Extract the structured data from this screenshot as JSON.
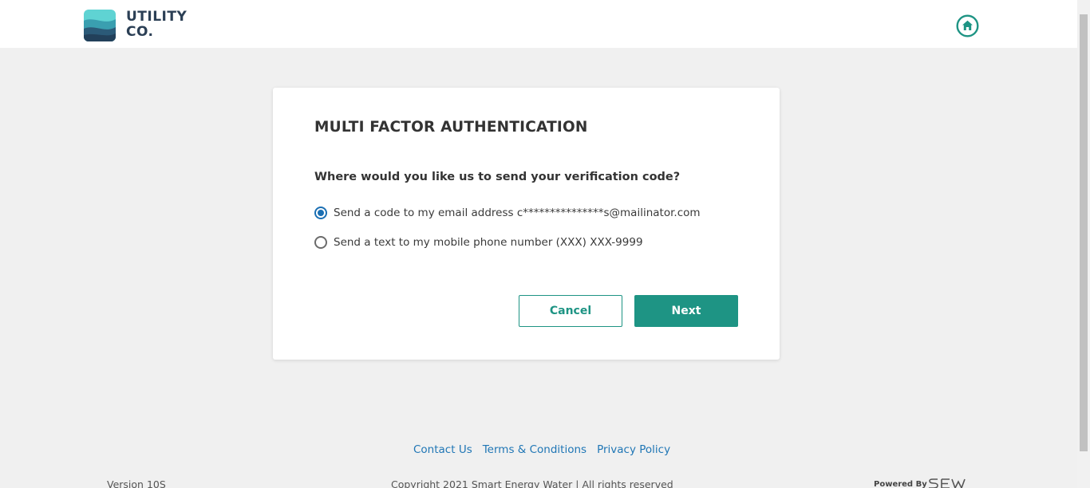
{
  "header": {
    "brand_line1": "UTILITY",
    "brand_line2": "CO.",
    "home_icon": "home-icon"
  },
  "colors": {
    "accent": "#1e9484",
    "link": "#1f76b5",
    "radio": "#1b6fb3"
  },
  "card": {
    "title": "MULTI FACTOR AUTHENTICATION",
    "question": "Where would you like us to send your verification code?",
    "options": [
      {
        "label": "Send a code to my email address c***************s@mailinator.com",
        "checked": true
      },
      {
        "label": "Send a text to my mobile phone number (XXX) XXX-9999",
        "checked": false
      }
    ],
    "cancel_label": "Cancel",
    "next_label": "Next"
  },
  "footer": {
    "links": [
      "Contact Us",
      "Terms & Conditions",
      "Privacy Policy"
    ],
    "version": "Version 10S",
    "copyright": "Copyright 2021 Smart Energy Water | All rights reserved",
    "powered_by": "Powered By"
  }
}
